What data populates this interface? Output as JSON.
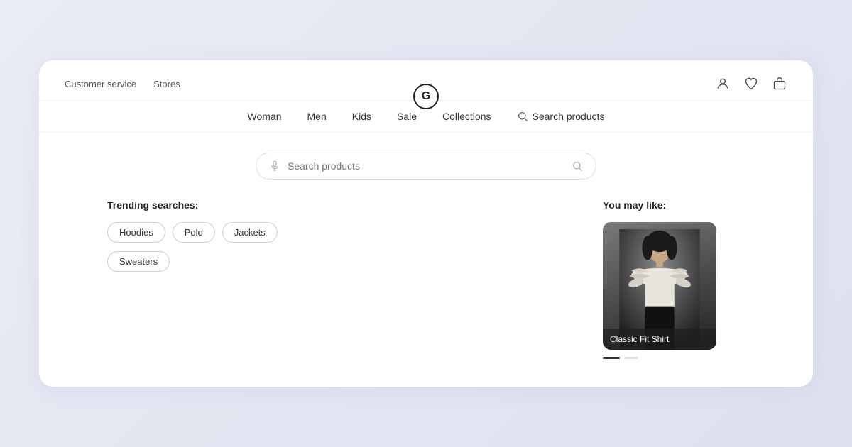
{
  "topbar": {
    "left": [
      {
        "label": "Customer service",
        "key": "customer-service"
      },
      {
        "label": "Stores",
        "key": "stores"
      }
    ],
    "logo_letter": "G",
    "right_icons": [
      "user-icon",
      "heart-icon",
      "bag-icon"
    ]
  },
  "nav": {
    "links": [
      {
        "label": "Woman",
        "key": "woman"
      },
      {
        "label": "Men",
        "key": "men"
      },
      {
        "label": "Kids",
        "key": "kids"
      },
      {
        "label": "Sale",
        "key": "sale"
      },
      {
        "label": "Collections",
        "key": "collections"
      }
    ],
    "search_label": "Search products"
  },
  "search": {
    "placeholder": "Search products"
  },
  "trending": {
    "title": "Trending searches:",
    "tags": [
      "Hoodies",
      "Polo",
      "Jackets",
      "Sweaters"
    ]
  },
  "you_may_like": {
    "title": "You may like:",
    "products": [
      {
        "name": "Classic Fit Shirt"
      }
    ]
  },
  "dots": [
    {
      "active": true
    },
    {
      "active": false
    }
  ]
}
